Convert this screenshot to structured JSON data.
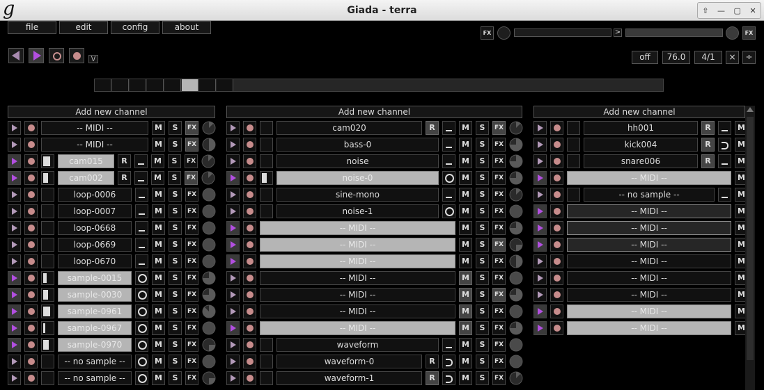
{
  "window": {
    "title": "Giada - terra",
    "logo": "g"
  },
  "menu": {
    "file": "file",
    "edit": "edit",
    "config": "config",
    "about": "about"
  },
  "transport": {
    "fx_label": "FX",
    "fx_out_label": "FX",
    "io_arrow": ">"
  },
  "timing": {
    "metronome": "\\/",
    "input_rec": "off",
    "bpm": "76.0",
    "meter": "4/1",
    "multiply": "×",
    "divide": "÷"
  },
  "sequencer": {
    "beats": 8,
    "current_beat": 6
  },
  "columns": [
    {
      "add_label": "Add new channel",
      "rows": [
        {
          "name": "-- MIDI --",
          "mode": "none",
          "fx_active": true,
          "knob": "ne"
        },
        {
          "name": "-- MIDI --",
          "mode": "none",
          "fx_active": true,
          "knob": "half"
        },
        {
          "name": "cam015",
          "mode": "bar",
          "r": true,
          "playing": true,
          "hl": true,
          "wave": 0.75,
          "knob": "ne"
        },
        {
          "name": "cam002",
          "mode": "bar",
          "r": true,
          "playing": true,
          "hl": true,
          "wave": 0.5,
          "fx_active": true,
          "knob": "ne"
        },
        {
          "name": "loop-0006",
          "mode": "bar",
          "knob": "full"
        },
        {
          "name": "loop-0007",
          "mode": "bar",
          "knob": "full"
        },
        {
          "name": "loop-0668",
          "mode": "bar",
          "knob": "full"
        },
        {
          "name": "loop-0669",
          "mode": "bar",
          "knob": "full"
        },
        {
          "name": "loop-0670",
          "mode": "bar",
          "knob": "full"
        },
        {
          "name": "sample-0015",
          "mode": "ring",
          "playing": true,
          "hl": true,
          "wave": 0.4,
          "knob": "q3"
        },
        {
          "name": "sample-0030",
          "mode": "ring",
          "playing": true,
          "hl": true,
          "wave": 0.5,
          "knob": "q3"
        },
        {
          "name": "sample-0961",
          "mode": "ring",
          "playing": true,
          "hl": true,
          "wave": 0.8,
          "knob": "q3b"
        },
        {
          "name": "sample-0967",
          "mode": "ring",
          "playing": true,
          "hl": true,
          "wave": 0.2,
          "knob": "full"
        },
        {
          "name": "sample-0970",
          "mode": "ring",
          "playing": true,
          "hl": true,
          "wave": 0.6,
          "knob": "q1"
        },
        {
          "name": "-- no sample --",
          "mode": "ring",
          "knob": "full"
        },
        {
          "name": "-- no sample --",
          "mode": "ring",
          "knob": "q1"
        }
      ]
    },
    {
      "add_label": "Add new channel",
      "rows": [
        {
          "name": "cam020",
          "mode": "bar",
          "r": true,
          "r_active": true,
          "fx_active": true,
          "knob": "ne"
        },
        {
          "name": "bass-0",
          "mode": "bar",
          "knob": "q3"
        },
        {
          "name": "noise",
          "mode": "bar",
          "knob": "q3"
        },
        {
          "name": "noise-0",
          "mode": "ring",
          "playing": true,
          "hl": true,
          "wave": 0.5,
          "knob": "q3"
        },
        {
          "name": "sine-mono",
          "mode": "bar",
          "knob": "ne"
        },
        {
          "name": "noise-1",
          "mode": "ring",
          "knob": "full"
        },
        {
          "name": "-- MIDI --",
          "mode": "none",
          "playing": true,
          "hl": true,
          "wide": true,
          "knob": "q3"
        },
        {
          "name": "-- MIDI --",
          "mode": "none",
          "playing": true,
          "hl": true,
          "wide": true,
          "fx_active": true,
          "knob": "q1"
        },
        {
          "name": "-- MIDI --",
          "mode": "none",
          "playing": true,
          "hl": true,
          "wide": true,
          "knob": "half"
        },
        {
          "name": "-- MIDI --",
          "mode": "none",
          "wide": true,
          "m_active": true,
          "knob": "full"
        },
        {
          "name": "-- MIDI --",
          "mode": "none",
          "wide": true,
          "m_active": true,
          "fx_active": true,
          "knob": "q3"
        },
        {
          "name": "-- MIDI --",
          "mode": "none",
          "wide": true,
          "m_active": true,
          "knob": "full"
        },
        {
          "name": "-- MIDI --",
          "mode": "none",
          "playing": true,
          "hl": true,
          "wide": true,
          "m_active": true,
          "knob": "q3"
        },
        {
          "name": "waveform",
          "mode": "bar",
          "knob": "full"
        },
        {
          "name": "waveform-0",
          "mode": "loop",
          "r": true,
          "knob": "full"
        },
        {
          "name": "waveform-1",
          "mode": "loop",
          "r": true,
          "r_active": true,
          "knob": "ne"
        }
      ]
    },
    {
      "add_label": "Add new channel",
      "rows": [
        {
          "name": "hh001",
          "mode": "bar",
          "r": true,
          "r_active": true
        },
        {
          "name": "kick004",
          "mode": "loop",
          "r": true,
          "r_active": true
        },
        {
          "name": "snare006",
          "mode": "bar",
          "r": true,
          "r_active": true
        },
        {
          "name": "-- MIDI --",
          "mode": "none",
          "playing": true,
          "hl": true,
          "wide3": true
        },
        {
          "name": "-- no sample --",
          "mode": "bar"
        },
        {
          "name": "-- MIDI --",
          "mode": "none",
          "playing": true,
          "dk": true,
          "wide3": true
        },
        {
          "name": "-- MIDI --",
          "mode": "none",
          "playing": true,
          "dk": true,
          "wide3": true
        },
        {
          "name": "-- MIDI --",
          "mode": "none",
          "playing": true,
          "dk": true,
          "wide3": true
        },
        {
          "name": "-- MIDI --",
          "mode": "none",
          "wide3": true
        },
        {
          "name": "-- MIDI --",
          "mode": "none",
          "wide3": true
        },
        {
          "name": "-- MIDI --",
          "mode": "none",
          "wide3": true
        },
        {
          "name": "-- MIDI --",
          "mode": "none",
          "playing": true,
          "hl": true,
          "wide3": true
        },
        {
          "name": "-- MIDI --",
          "mode": "none",
          "playing": true,
          "hl": true,
          "wide3": true
        }
      ]
    }
  ],
  "labels": {
    "r": "R",
    "m": "M",
    "s": "S",
    "fx": "FX"
  },
  "colors": {
    "play": "#b24fe0",
    "rec": "#c78c8c",
    "highlight": "#b5b5b5"
  }
}
